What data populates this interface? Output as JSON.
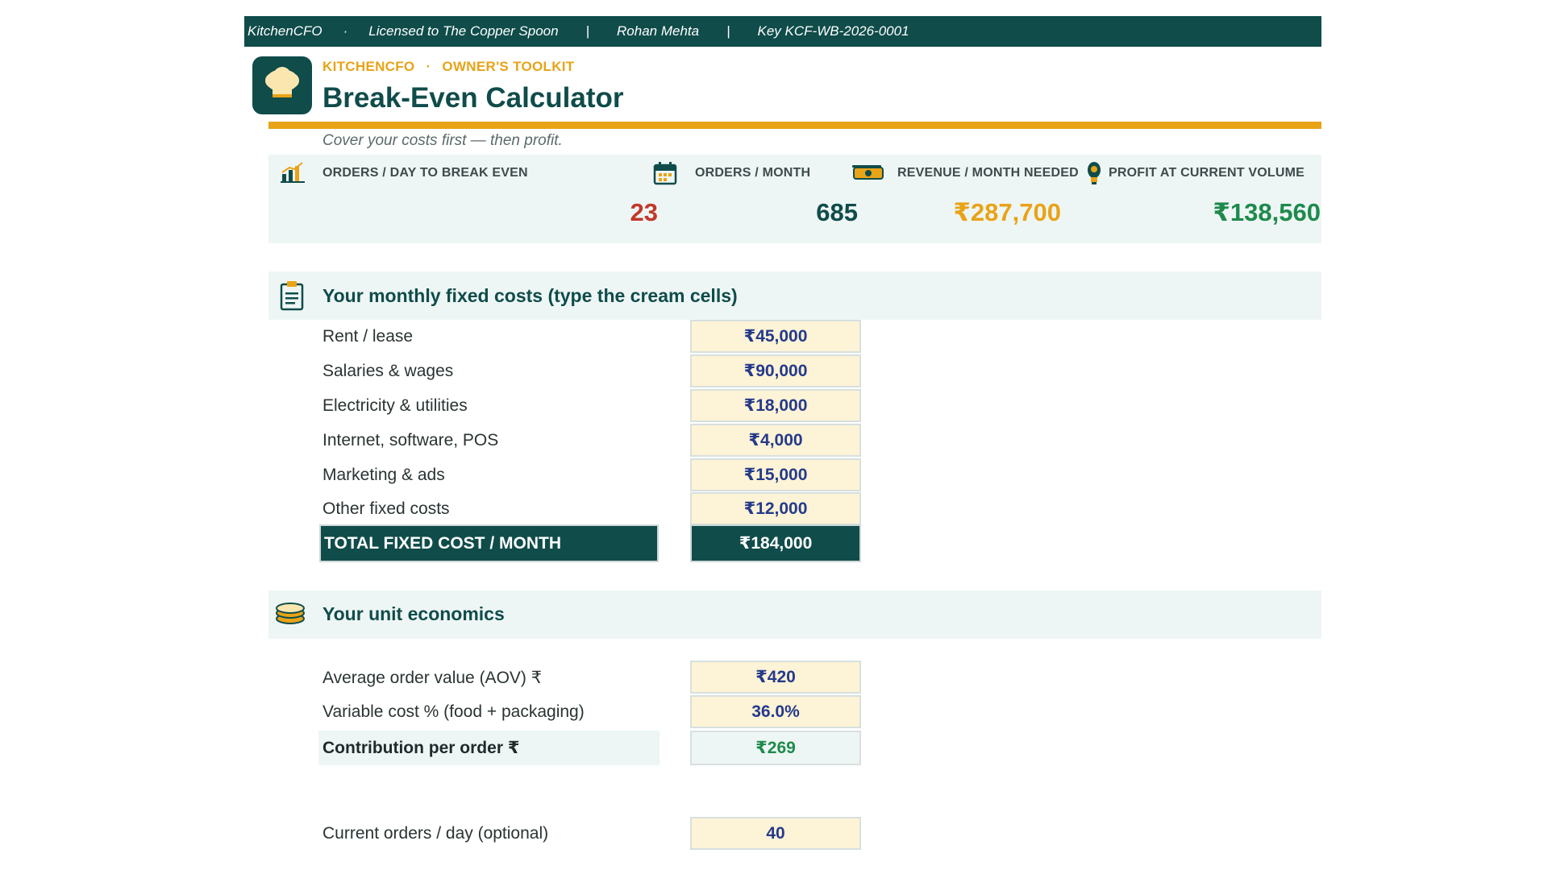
{
  "license_bar": {
    "product": "KitchenCFO",
    "dot": "·",
    "licensee": "Licensed to The Copper Spoon",
    "pipe1": "|",
    "user": "Rohan Mehta",
    "pipe2": "|",
    "key": "Key KCF-WB-2026-0001"
  },
  "header": {
    "brand": "KITCHENCFO",
    "brand_sep": "·",
    "toolkit": "OWNER'S TOOLKIT",
    "title": "Break-Even Calculator",
    "tagline": "Cover your costs first — then profit."
  },
  "kpis": [
    {
      "label": "ORDERS / DAY TO BREAK EVEN",
      "value": "23",
      "icon": "bar-chart-icon",
      "color": "#c0392b"
    },
    {
      "label": "ORDERS / MONTH",
      "value": "685",
      "icon": "calendar-icon",
      "color": "#0f4c4a"
    },
    {
      "label": "REVENUE / MONTH NEEDED",
      "value": "₹287,700",
      "icon": "cash-icon",
      "color": "#e8a317"
    },
    {
      "label": "PROFIT AT CURRENT VOLUME",
      "value": "₹138,560",
      "icon": "lightbulb-icon",
      "color": "#1e8a4c"
    }
  ],
  "fixed_costs": {
    "title": "Your monthly fixed costs (type the cream cells)",
    "icon": "clipboard-icon",
    "rows": [
      {
        "label": "Rent / lease",
        "value": "₹45,000"
      },
      {
        "label": "Salaries & wages",
        "value": "₹90,000"
      },
      {
        "label": "Electricity & utilities",
        "value": "₹18,000"
      },
      {
        "label": "Internet, software, POS",
        "value": "₹4,000"
      },
      {
        "label": "Marketing & ads",
        "value": "₹15,000"
      },
      {
        "label": "Other fixed costs",
        "value": "₹12,000"
      }
    ],
    "total_label": "TOTAL FIXED COST / MONTH",
    "total_value": "₹184,000"
  },
  "unit_economics": {
    "title": "Your unit economics",
    "icon": "coins-icon",
    "aov_label": "Average order value (AOV) ₹",
    "aov_value": "₹420",
    "var_label": "Variable cost % (food + packaging)",
    "var_value": "36.0%",
    "contrib_label": "Contribution per order ₹",
    "contrib_value": "₹269",
    "orders_label": "Current orders / day (optional)",
    "orders_value": "40"
  },
  "colors": {
    "brand_teal": "#0f4c4a",
    "accent_gold": "#e8a317",
    "cream_input": "#fdf3d6",
    "panel": "#eef6f5"
  }
}
